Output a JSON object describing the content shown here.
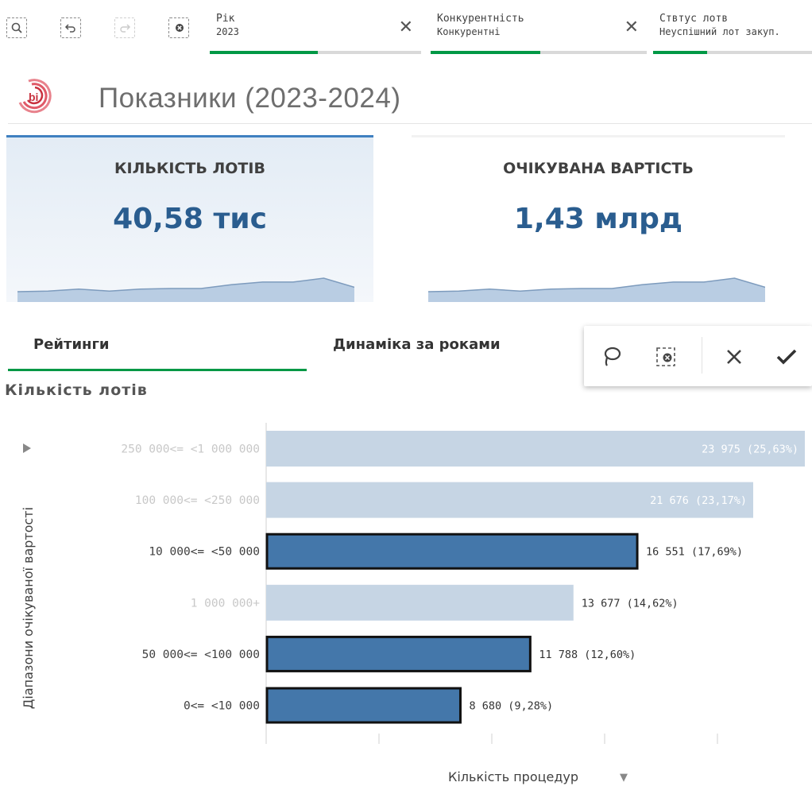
{
  "toolbar": {
    "icons": [
      "smart-search-icon",
      "step-back-icon",
      "step-forward-icon",
      "clear-selections-icon"
    ],
    "chips": [
      {
        "title": "Рік",
        "value": "2023",
        "progress": 0.5
      },
      {
        "title": "Конкурентність",
        "value": "Конкурентні",
        "progress": 0.5
      },
      {
        "title": "Ствтус лотв",
        "value": "Неуспішний лот закуп.",
        "progress": 0.33
      }
    ]
  },
  "header": {
    "logo_text": "bi",
    "title": "Показники (2023-2024)"
  },
  "kpis": [
    {
      "label": "КІЛЬКІСТЬ ЛОТІВ",
      "value": "40,58 тис",
      "selected": true
    },
    {
      "label": "ОЧІКУВАНА ВАРТІСТЬ",
      "value": "1,43 млрд",
      "selected": false
    }
  ],
  "sparkline": [
    0.16,
    0.17,
    0.2,
    0.17,
    0.2,
    0.21,
    0.21,
    0.27,
    0.31,
    0.31,
    0.37,
    0.23
  ],
  "tabs": [
    {
      "label": "Рейтинги",
      "active": true
    },
    {
      "label": "Динаміка за роками",
      "active": false
    }
  ],
  "selection_tools": {
    "icons": [
      "lasso-icon",
      "clear-selection-icon",
      "cancel-icon",
      "confirm-icon"
    ]
  },
  "chart_data": {
    "type": "bar",
    "orientation": "horizontal",
    "title": "Кількість лотів",
    "ylabel": "Діапазони очікуваної вартості",
    "xlabel": "Кількість процедур",
    "sort_indicator": "▼",
    "categories": [
      "250 000<= <1 000 000",
      "100 000<= <250 000",
      "10 000<= <50 000",
      "1 000 000+",
      "50 000<= <100 000",
      "0<= <10 000"
    ],
    "values": [
      23975,
      21676,
      16551,
      13677,
      11788,
      8680
    ],
    "value_labels": [
      "23 975 (25,63%)",
      "21 676 (23,17%)",
      "16 551 (17,69%)",
      "13 677 (14,62%)",
      "11 788 (12,60%)",
      "8 680 (9,28%)"
    ],
    "selected": [
      false,
      false,
      true,
      false,
      true,
      true
    ],
    "dimmed_label_color": [
      true,
      true,
      false,
      true,
      false,
      false
    ],
    "xlim": [
      0,
      24000
    ],
    "colors": {
      "selected": "#4477aa",
      "unselected": "#c6d5e4",
      "selected_border": "#111111"
    }
  }
}
